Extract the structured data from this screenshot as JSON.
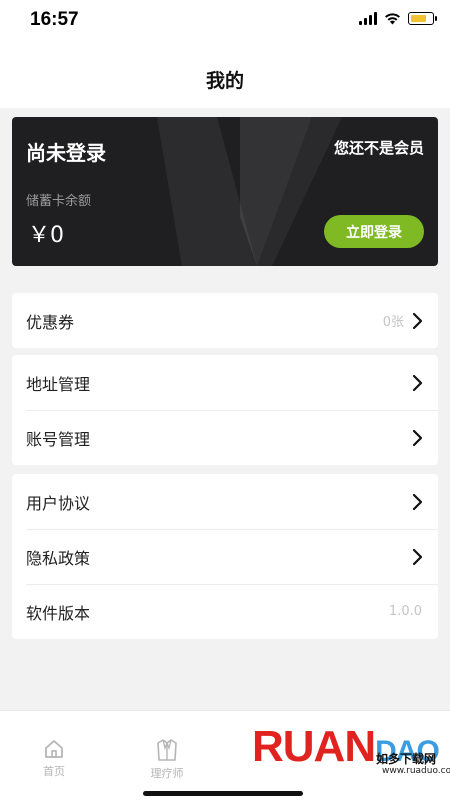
{
  "status_bar": {
    "time": "16:57"
  },
  "header": {
    "title": "我的"
  },
  "member_card": {
    "login_status": "尚未登录",
    "member_status": "您还不是会员",
    "balance_label": "储蓄卡余额",
    "balance_value": "￥0",
    "login_button": "立即登录",
    "accent_color": "#7fba24"
  },
  "menu_groups": [
    [
      {
        "label": "优惠券",
        "value": "0张",
        "icon": "chevron-right-icon"
      }
    ],
    [
      {
        "label": "地址管理",
        "icon": "chevron-right-icon"
      },
      {
        "label": "账号管理",
        "icon": "chevron-right-icon"
      }
    ],
    [
      {
        "label": "用户协议",
        "icon": "chevron-right-icon"
      },
      {
        "label": "隐私政策",
        "icon": "chevron-right-icon"
      },
      {
        "label": "软件版本",
        "value": "1.0.0"
      }
    ]
  ],
  "bottom_nav": [
    {
      "label": "首页",
      "icon": "home-icon"
    },
    {
      "label": "理疗师",
      "icon": "coat-icon"
    }
  ],
  "watermark": {
    "brand": "RUANDAO",
    "cn_text": "如多下载网",
    "url": "www.ruaduo.com"
  }
}
